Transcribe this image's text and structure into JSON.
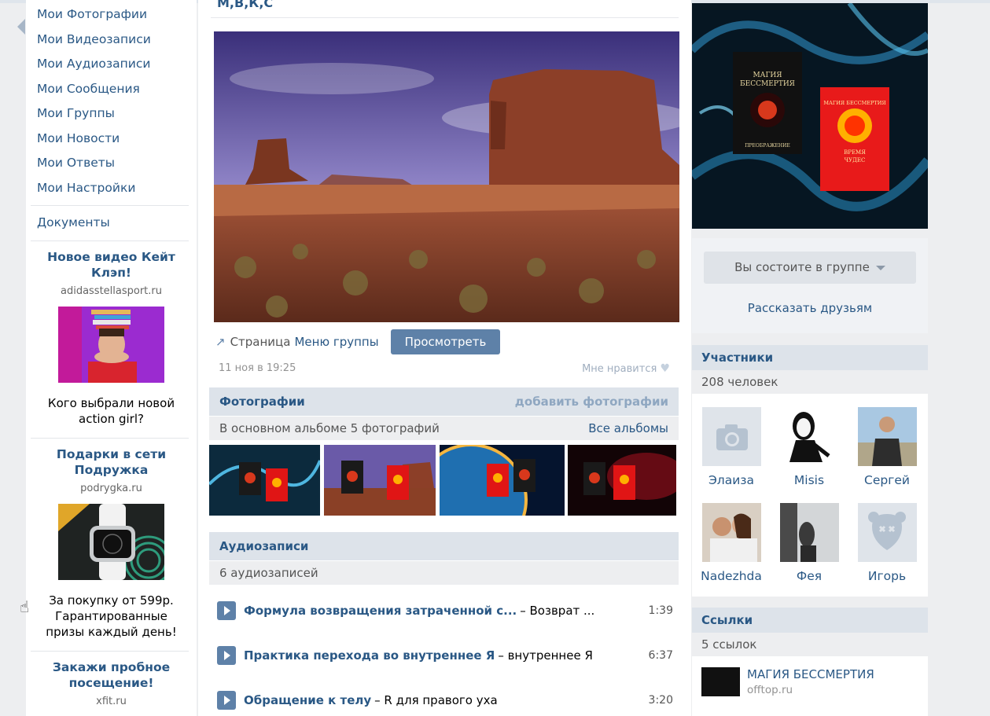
{
  "left_menu": [
    "Мои Фотографии",
    "Мои Видеозаписи",
    "Мои Аудиозаписи",
    "Мои Сообщения",
    "Мои Группы",
    "Мои Новости",
    "Мои Ответы",
    "Мои Настройки"
  ],
  "documents_label": "Документы",
  "ads": [
    {
      "title": "Новое видео Кейт Клэп!",
      "domain": "adidasstellasport.ru",
      "text": "Кого выбрали новой action girl?"
    },
    {
      "title": "Подарки в сети Подружка",
      "domain": "podrygka.ru",
      "text": "За покупку от 599р. Гарантированные призы каждый день!"
    },
    {
      "title": "Закажи пробное посещение!",
      "domain": "xfit.ru"
    }
  ],
  "wall": {
    "title": "М,В,К,С",
    "page_label": "Страница",
    "page_link": "Меню группы",
    "view_button": "Просмотреть",
    "date": "11 ноя в 19:25",
    "like": "Мне нравится"
  },
  "photos": {
    "header": "Фотографии",
    "add": "добавить фотографии",
    "subtitle": "В основном альбоме 5 фотографий",
    "all_albums": "Все альбомы"
  },
  "audio": {
    "header": "Аудиозаписи",
    "count": "6 аудиозаписей",
    "tracks": [
      {
        "title": "Формула возвращения затраченной с...",
        "artist": "– Возврат ...",
        "duration": "1:39"
      },
      {
        "title": "Практика перехода во внутреннее Я",
        "artist": "– внутреннее Я",
        "duration": "6:37"
      },
      {
        "title": "Обращение к телу",
        "artist": "– R для правого уха",
        "duration": "3:20"
      }
    ]
  },
  "membership": {
    "button": "Вы состоите в группе",
    "share": "Рассказать друзьям"
  },
  "members": {
    "header": "Участники",
    "count": "208 человек",
    "list": [
      "Элаиза",
      "Misis",
      "Сергей",
      "Nadezhda",
      "Фея",
      "Игорь"
    ]
  },
  "links": {
    "header": "Ссылки",
    "count": "5 ссылок",
    "item_title": "МАГИЯ БЕССМЕРТИЯ",
    "item_url": "offtop.ru"
  },
  "cover": {
    "book1": [
      "МАГИЯ",
      "БЕССМЕРТИЯ",
      "ПРЕОБРАЖЕНИЕ"
    ],
    "book2": [
      "МАГИЯ БЕССМЕРТИЯ",
      "ВРЕМЯ",
      "ЧУДЕС"
    ]
  },
  "icons": {
    "back": "chevron-left-icon",
    "cursor": "hand-pointer-icon",
    "heart": "heart-icon",
    "play": "play-icon",
    "camera": "camera-icon",
    "page": "page-arrow-icon"
  },
  "colors": {
    "link": "#2a5885",
    "button": "#5e81a8",
    "header_bg": "#dde3ea",
    "page_bg": "#edeef0"
  }
}
